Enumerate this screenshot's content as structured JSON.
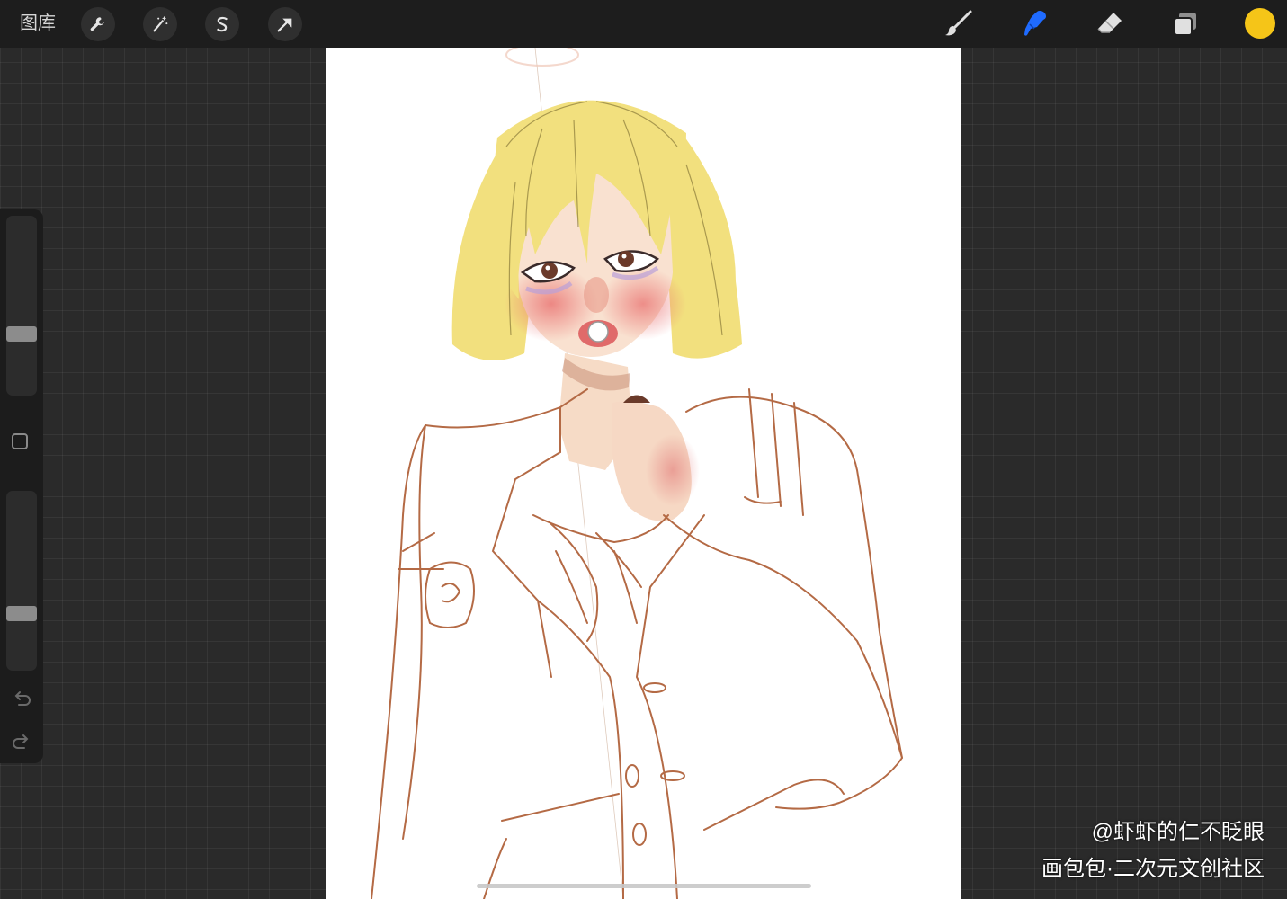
{
  "toolbar": {
    "gallery_label": "图库",
    "left_tools": [
      "wrench-icon",
      "magic-wand-icon",
      "selection-s-icon",
      "transform-arrow-icon"
    ],
    "right_tools": [
      "brush-icon",
      "smudge-icon",
      "eraser-icon",
      "layers-icon"
    ],
    "active_tool": "smudge",
    "current_color": "#f5c518"
  },
  "sidebar": {
    "brush_size_level": 0.33,
    "opacity_level": 0.3
  },
  "watermark": {
    "author": "@虾虾的仁不眨眼",
    "site": "画包包·二次元文创社区"
  },
  "colors": {
    "hair": "#f2e07e",
    "skin": "#f8dcc8",
    "blush": "#ee8a86",
    "sketch_line": "#b46a45",
    "active_tool": "#1f6bff"
  }
}
